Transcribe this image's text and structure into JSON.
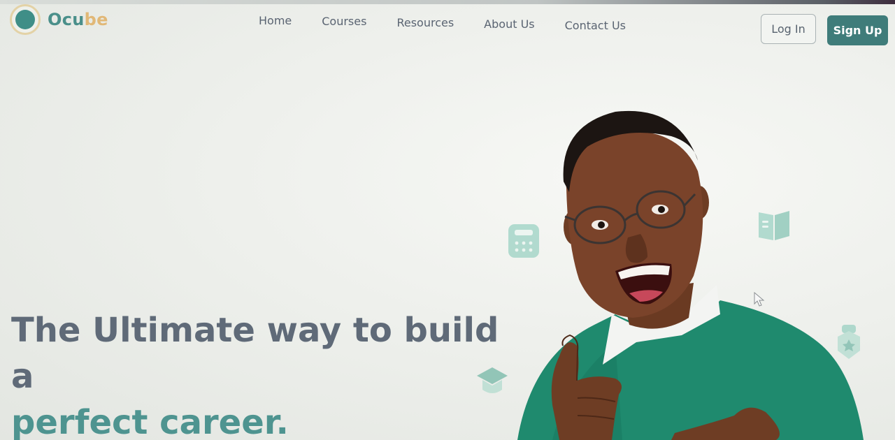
{
  "brand": {
    "name_part1": "Ocu",
    "name_part2": "be"
  },
  "nav": {
    "items": [
      "Home",
      "Courses",
      "Resources",
      "About Us",
      "Contact Us"
    ]
  },
  "auth": {
    "login_label": "Log In",
    "signup_label": "Sign Up"
  },
  "hero": {
    "line1": "The Ultimate way to build",
    "line2": "a",
    "line3": "perfect career."
  },
  "colors": {
    "primary_teal": "#3f7c7a",
    "accent_gold": "#e1b877",
    "heading_gray": "#5f6a78",
    "heading_teal": "#4e9490",
    "sweater_green": "#1f8a6e"
  },
  "icons": {
    "floating": [
      "calculator-icon",
      "book-icon",
      "graduation-cap-icon",
      "badge-icon"
    ]
  }
}
